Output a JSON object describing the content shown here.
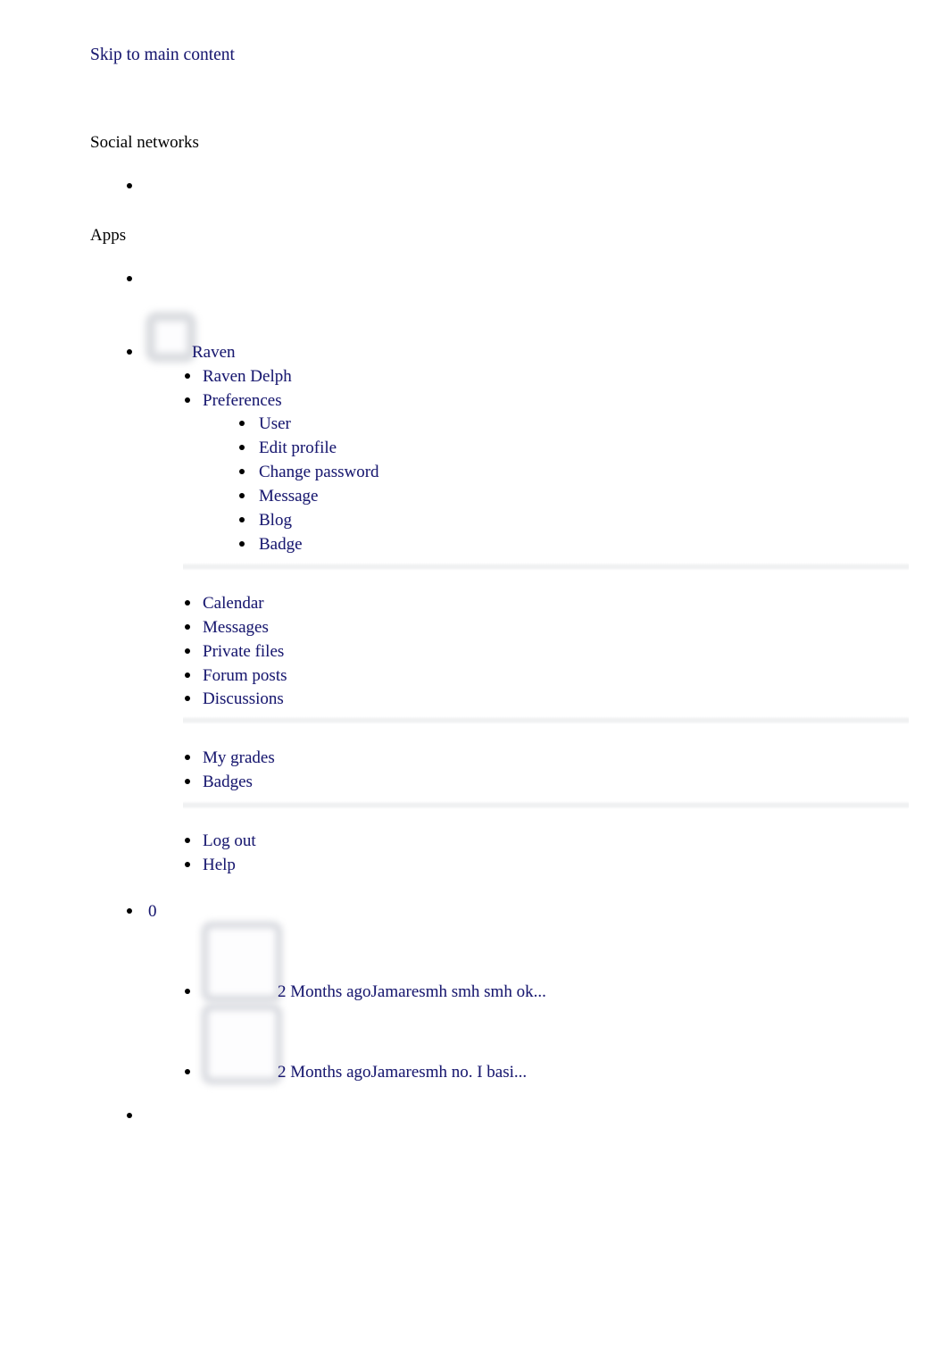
{
  "page": {
    "skip_link_label": "Skip to main content",
    "link_color": "#191970",
    "text_color": "#000000",
    "background_color": "#ffffff",
    "divider_color": "#f0f1f2"
  },
  "social_networks": {
    "heading": "Social networks",
    "items": [
      {
        "label": "",
        "icon": "social-link-placeholder"
      }
    ]
  },
  "apps": {
    "heading": "Apps",
    "items": [
      {
        "label": "",
        "icon": "app-link-placeholder"
      }
    ]
  },
  "user_menu": {
    "avatar_icon": "broken-image-avatar",
    "user_name": "Raven",
    "items": [
      {
        "label": "Raven Delph"
      },
      {
        "label": "Preferences"
      }
    ],
    "preferences": [
      {
        "label": "User"
      },
      {
        "label": "Edit profile"
      },
      {
        "label": "Change password"
      },
      {
        "label": "Message"
      },
      {
        "label": "Blog"
      },
      {
        "label": "Badge"
      }
    ],
    "group_activity": [
      {
        "label": "Calendar"
      },
      {
        "label": "Messages"
      },
      {
        "label": "Private files"
      },
      {
        "label": "Forum posts"
      },
      {
        "label": "Discussions"
      }
    ],
    "group_reports": [
      {
        "label": "My grades"
      },
      {
        "label": "Badges"
      }
    ],
    "group_session": [
      {
        "label": "Log out"
      },
      {
        "label": "Help"
      }
    ]
  },
  "notifications": {
    "count": "0"
  },
  "messages": {
    "items": [
      {
        "thumbnail_icon": "broken-image-message-thumb",
        "text": "2 Months agoJamaresmh  smh smh ok..."
      },
      {
        "thumbnail_icon": "broken-image-message-thumb",
        "text": "2 Months agoJamaresmh  no. I basi..."
      }
    ]
  },
  "trailing_item": {
    "label": ""
  }
}
